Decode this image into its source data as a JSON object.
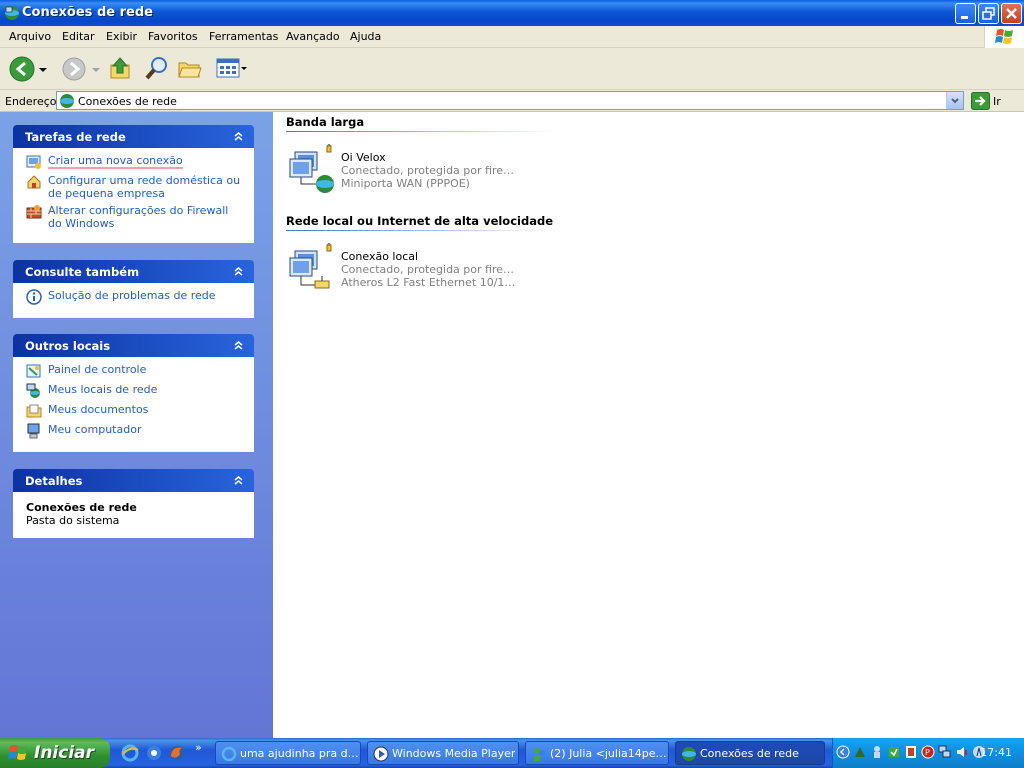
{
  "window": {
    "title": "Conexões de rede"
  },
  "menu": {
    "items": [
      "Arquivo",
      "Editar",
      "Exibir",
      "Favoritos",
      "Ferramentas",
      "Avançado",
      "Ajuda"
    ]
  },
  "address": {
    "label": "Endereço",
    "value": "Conexões de rede",
    "go_label": "Ir"
  },
  "sidebar": {
    "network_tasks": {
      "title": "Tarefas de rede",
      "items": [
        {
          "label": "Criar uma nova conexão",
          "icon": "new-connection-icon"
        },
        {
          "label": "Configurar uma rede doméstica ou de pequena empresa",
          "icon": "home-network-icon"
        },
        {
          "label": "Alterar configurações do Firewall do Windows",
          "icon": "firewall-icon"
        }
      ]
    },
    "see_also": {
      "title": "Consulte também",
      "items": [
        {
          "label": "Solução de problemas de rede",
          "icon": "info-icon"
        }
      ]
    },
    "other_places": {
      "title": "Outros locais",
      "items": [
        {
          "label": "Painel de controle",
          "icon": "control-panel-icon"
        },
        {
          "label": "Meus locais de rede",
          "icon": "network-places-icon"
        },
        {
          "label": "Meus documentos",
          "icon": "documents-folder-icon"
        },
        {
          "label": "Meu computador",
          "icon": "computer-icon"
        }
      ]
    },
    "details": {
      "title": "Detalhes",
      "name": "Conexões de rede",
      "type": "Pasta do sistema"
    }
  },
  "content": {
    "groups": [
      {
        "title": "Banda larga",
        "connections": [
          {
            "name": "Oi Velox",
            "status": "Conectado, protegida por fire…",
            "device": "Miniporta WAN (PPPOE)"
          }
        ]
      },
      {
        "title": "Rede local ou Internet de alta velocidade",
        "connections": [
          {
            "name": "Conexão local",
            "status": "Conectado, protegida por fire…",
            "device": "Atheros L2 Fast Ethernet 10/1…"
          }
        ]
      }
    ]
  },
  "taskbar": {
    "start_label": "Iniciar",
    "items": [
      {
        "label": "uma ajudinha pra d…",
        "active": false
      },
      {
        "label": "Windows Media Player",
        "active": false
      },
      {
        "label": "(2) Julia <julia14pe…",
        "active": false
      },
      {
        "label": "Conexões de rede",
        "active": true
      }
    ],
    "clock": "17:41"
  },
  "colors": {
    "title_bar": "#0b58d6",
    "sidebar_bg": "#7ba2e7",
    "link": "#215dc6",
    "taskbar": "#2157d7",
    "start_green": "#3c9a3c"
  }
}
